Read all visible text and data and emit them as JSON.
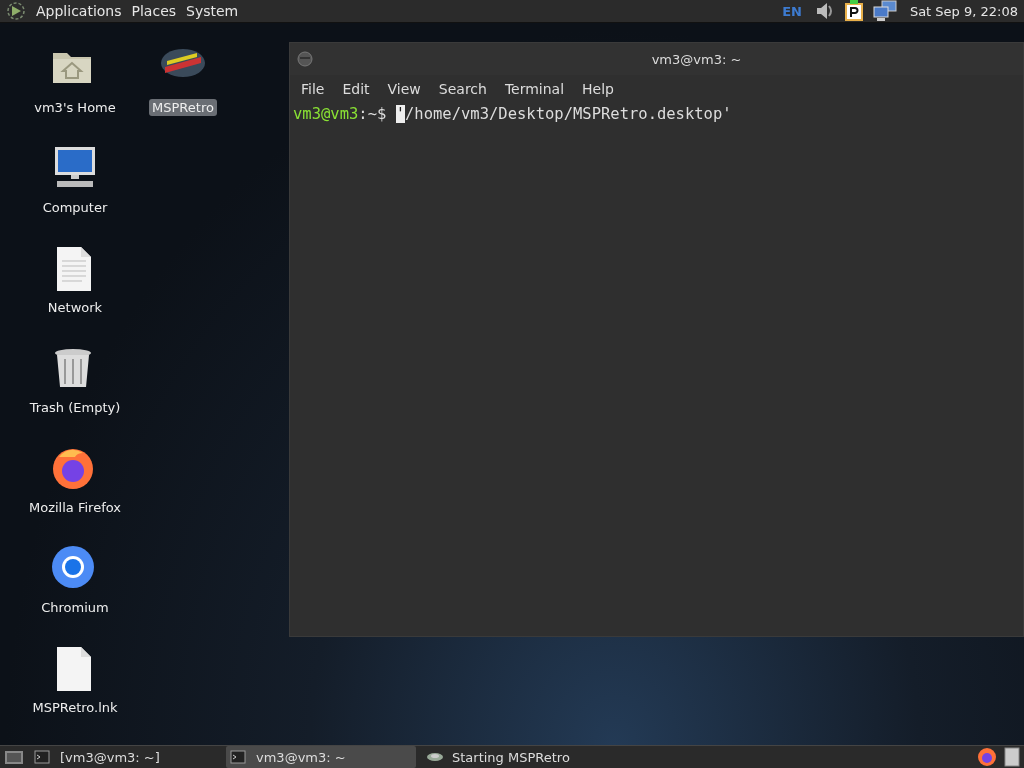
{
  "top_panel": {
    "menus": [
      "Applications",
      "Places",
      "System"
    ],
    "keyboard_layout": "EN",
    "clock": "Sat Sep 9, 22:08"
  },
  "desktop_icons": [
    {
      "label": "vm3's Home",
      "kind": "home",
      "selected": false
    },
    {
      "label": "Computer",
      "kind": "computer",
      "selected": false
    },
    {
      "label": "Network",
      "kind": "document",
      "selected": false
    },
    {
      "label": "Trash (Empty)",
      "kind": "trash",
      "selected": false
    },
    {
      "label": "Mozilla Firefox",
      "kind": "firefox",
      "selected": false
    },
    {
      "label": "Chromium",
      "kind": "chromium",
      "selected": false
    },
    {
      "label": "MSPRetro.lnk",
      "kind": "file",
      "selected": false
    },
    {
      "label": "MSPRetro",
      "kind": "app",
      "selected": true
    }
  ],
  "terminal": {
    "title": "vm3@vm3: ~",
    "menus": [
      "File",
      "Edit",
      "View",
      "Search",
      "Terminal",
      "Help"
    ],
    "prompt_user": "vm3@vm3",
    "prompt_path": ":~$",
    "cursor_char": "'",
    "command": "/home/vm3/Desktop/MSPRetro.desktop'"
  },
  "taskbar": {
    "items": [
      {
        "label": "[vm3@vm3: ~]",
        "kind": "terminal",
        "selected": false
      },
      {
        "label": "vm3@vm3: ~",
        "kind": "terminal",
        "selected": true
      },
      {
        "label": "Starting MSPRetro",
        "kind": "loading",
        "selected": false
      }
    ]
  }
}
